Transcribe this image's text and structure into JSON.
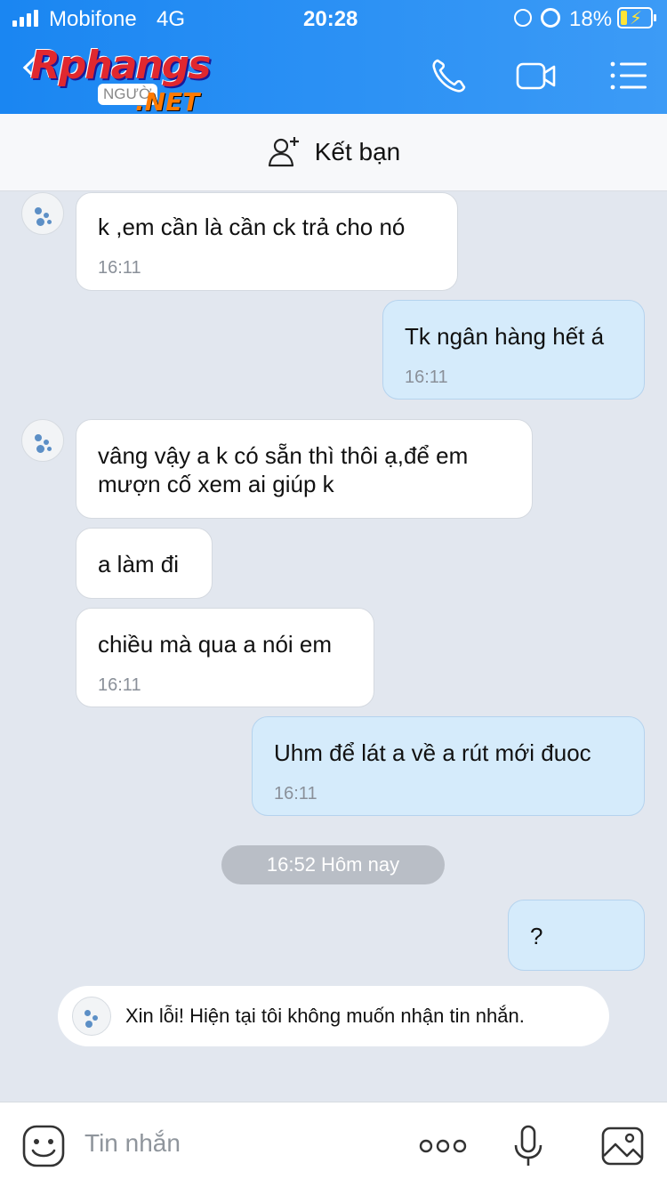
{
  "status": {
    "carrier": "Mobifone",
    "network": "4G",
    "time": "20:28",
    "battery": "18%"
  },
  "header": {
    "logo_text": "Rphangs",
    "logo_badge": "NGƯỜ",
    "logo_suffix": ".NET",
    "accent": "#1a86f2"
  },
  "friendbar": {
    "label": "Kết bạn"
  },
  "messages": [
    {
      "side": "in",
      "text": "k ,em cần là cần ck trả cho nó",
      "time": "16:11"
    },
    {
      "side": "out",
      "text": "Tk ngân hàng hết á",
      "time": "16:11"
    },
    {
      "side": "in",
      "text_line1": "vâng vậy a k có sẵn thì thôi ạ,để em",
      "text_line2": "mượn cố xem ai giúp k"
    },
    {
      "side": "in",
      "text": "a làm đi"
    },
    {
      "side": "in",
      "text": "chiều mà qua a nói em",
      "time": "16:11"
    },
    {
      "side": "out",
      "text": "Uhm để lát a về a rút mới đuoc",
      "time": "16:11"
    },
    {
      "side": "out",
      "text": "?"
    }
  ],
  "divider": "16:52 Hôm nay",
  "autoreply": "Xin lỗi! Hiện tại tôi không muốn nhận tin nhắn.",
  "composer": {
    "placeholder": "Tin nhắn"
  },
  "icons": [
    "call-icon",
    "video-icon",
    "menu-icon",
    "add-friend-icon",
    "emoji-icon",
    "more-icon",
    "mic-icon",
    "image-icon"
  ]
}
